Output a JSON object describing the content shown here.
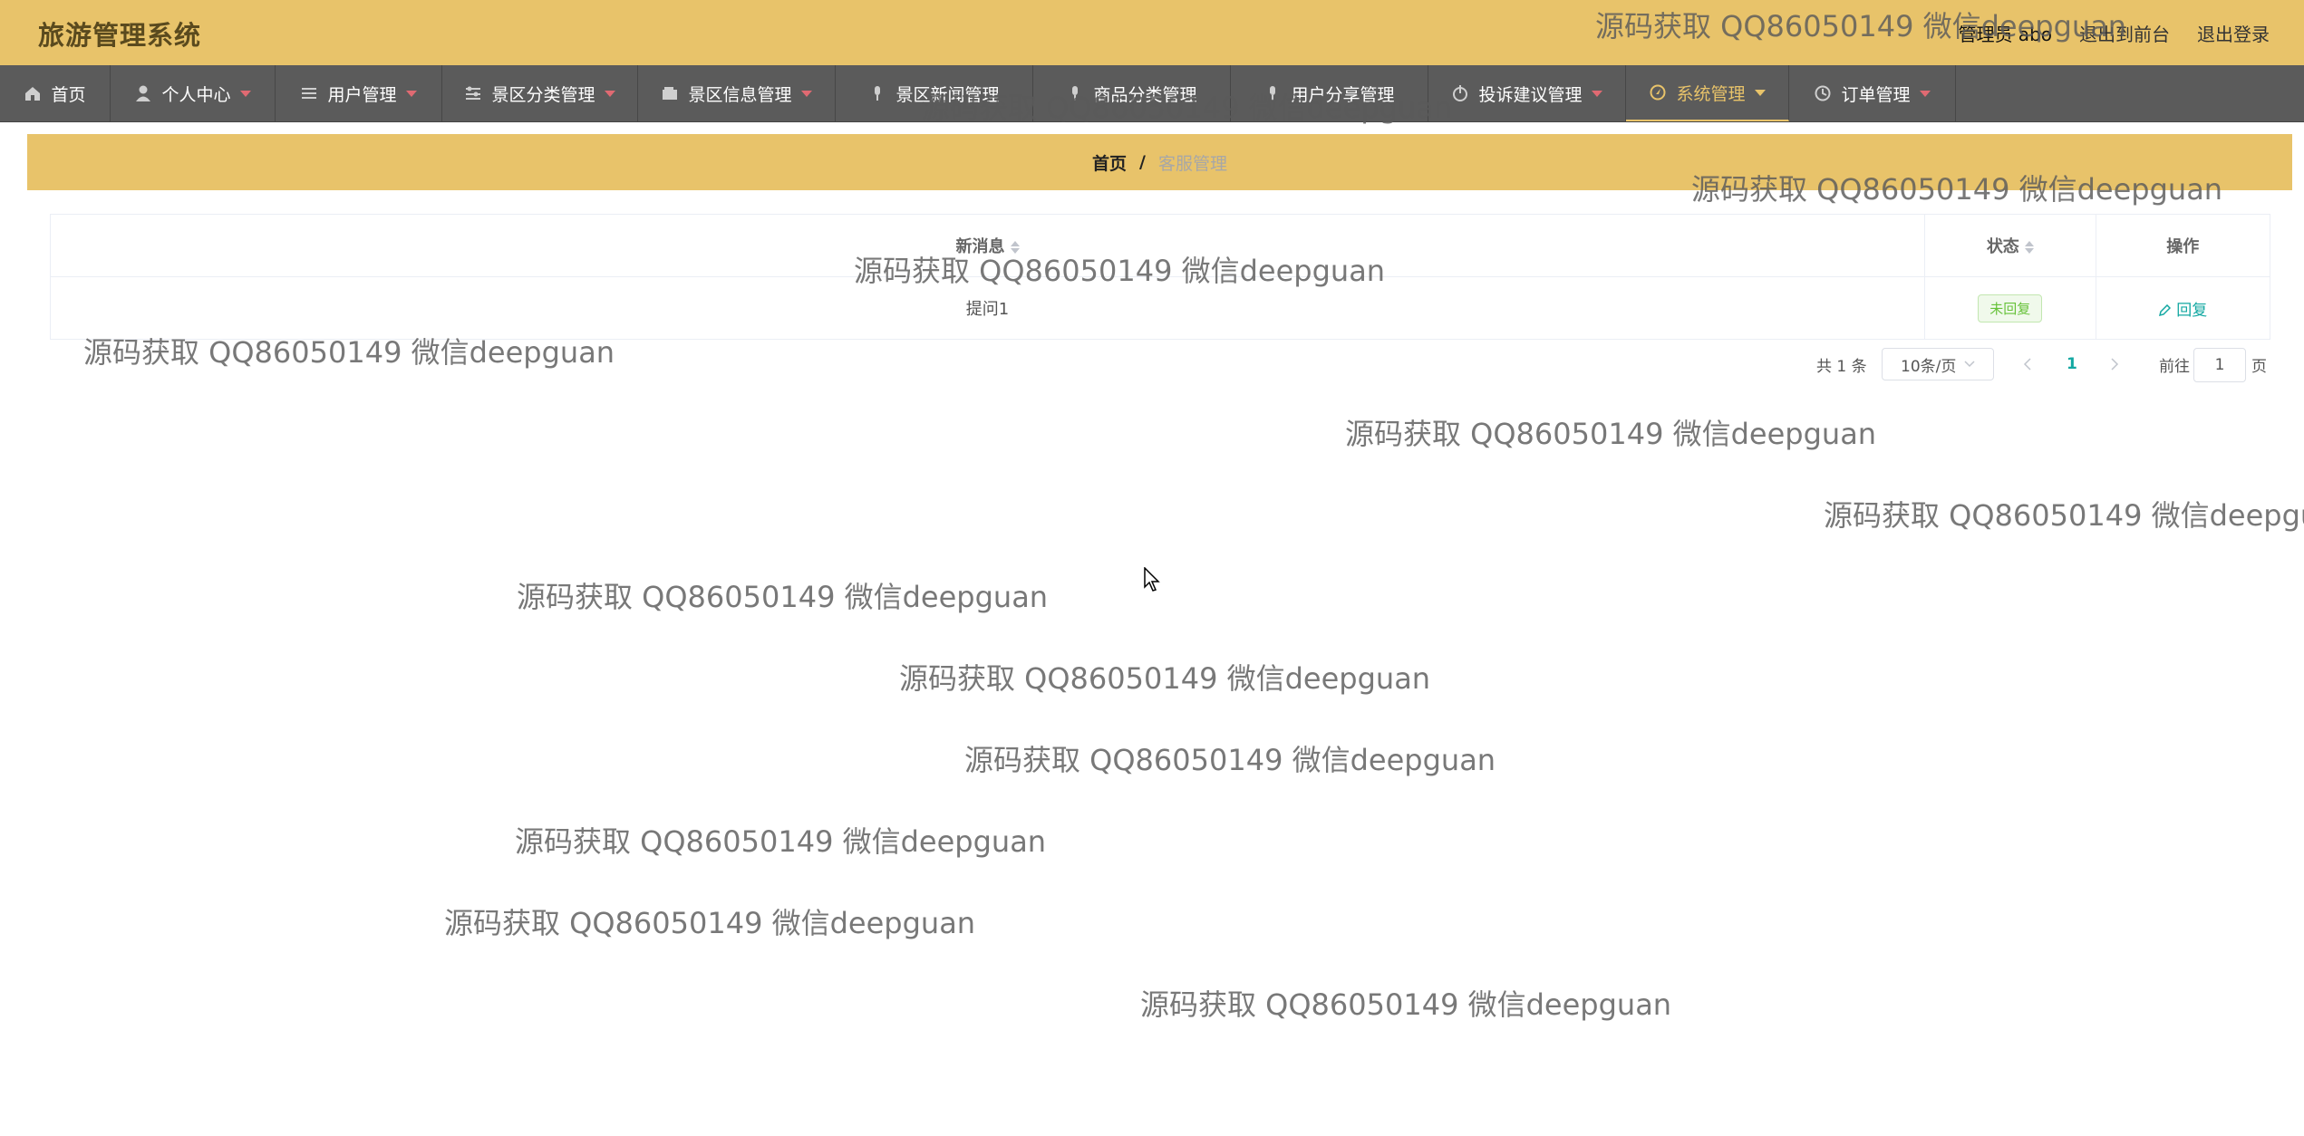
{
  "app": {
    "title": "旅游管理系统",
    "user_label": "管理员 abo",
    "to_front": "退出到前台",
    "logout": "退出登录"
  },
  "nav": [
    {
      "label": "首页",
      "icon": "home-icon",
      "active": false
    },
    {
      "label": "个人中心",
      "icon": "user-icon",
      "active": false
    },
    {
      "label": "用户管理",
      "icon": "list-icon",
      "active": false
    },
    {
      "label": "景区分类管理",
      "icon": "sliders-icon",
      "active": false
    },
    {
      "label": "景区信息管理",
      "icon": "wallet-icon",
      "active": false
    },
    {
      "label": "景区新闻管理",
      "icon": "mic-icon",
      "active": false
    },
    {
      "label": "商品分类管理",
      "icon": "mic-icon",
      "active": false
    },
    {
      "label": "用户分享管理",
      "icon": "mic-icon",
      "active": false
    },
    {
      "label": "投诉建议管理",
      "icon": "power-icon",
      "active": false
    },
    {
      "label": "系统管理",
      "icon": "compass-icon",
      "active": true
    },
    {
      "label": "订单管理",
      "icon": "clock-icon",
      "active": false
    }
  ],
  "breadcrumb": {
    "home": "首页",
    "separator": "/",
    "current": "客服管理"
  },
  "table": {
    "headers": {
      "message": "新消息",
      "status": "状态",
      "action": "操作"
    },
    "rows": [
      {
        "message": "提问1",
        "status": "未回复",
        "action": "回复"
      }
    ]
  },
  "pagination": {
    "total": "共 1 条",
    "page_size": "10条/页",
    "current_page": "1",
    "goto_label": "前往",
    "goto_value": "1",
    "page_suffix": "页"
  },
  "watermark": "源码获取 QQ86050149 微信deepguan",
  "colors": {
    "header_bg": "#e8c36a",
    "nav_bg": "#5b5b5b",
    "accent": "#13a8a2",
    "status_green": "#67c23a"
  }
}
